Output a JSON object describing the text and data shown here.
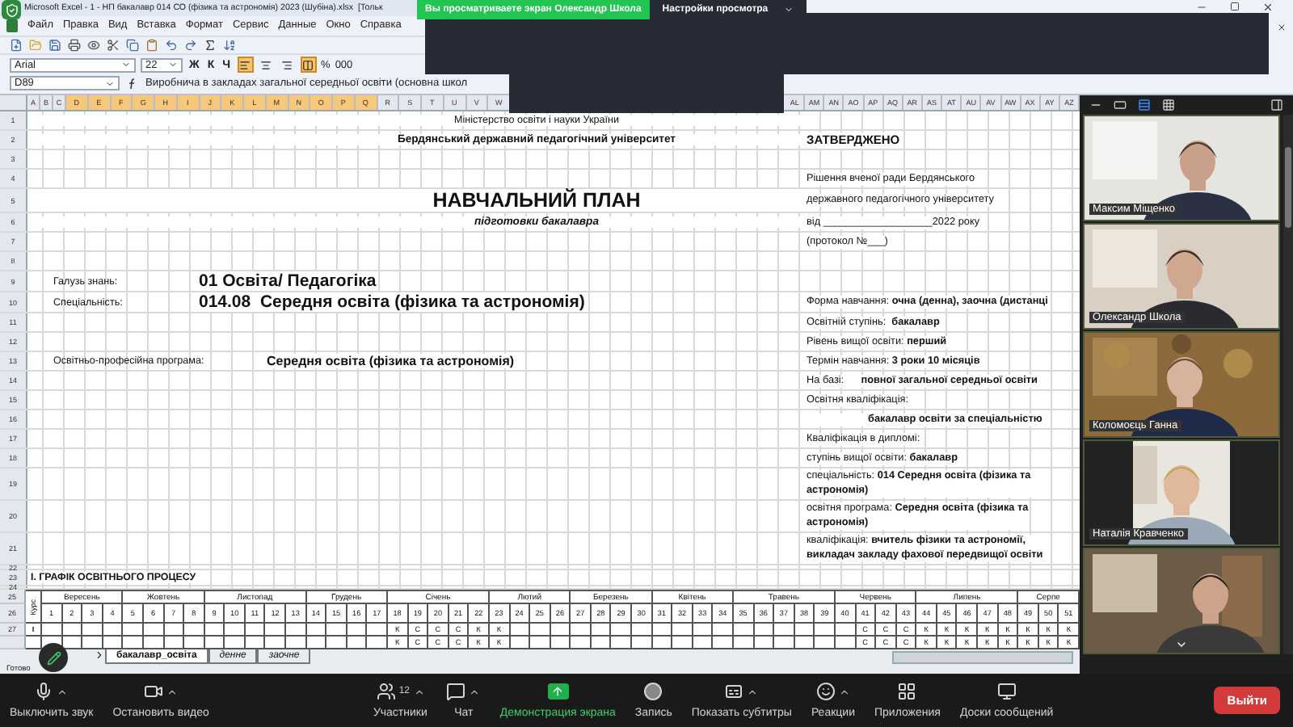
{
  "excel": {
    "title": "Microsoft Excel - 1 - НП бакалавр 014 СО (фізика та астрономія) 2023 (Шубіна).xlsx  [Тольк",
    "menu": [
      "Файл",
      "Правка",
      "Вид",
      "Вставка",
      "Формат",
      "Сервис",
      "Данные",
      "Окно",
      "Справка"
    ],
    "font": "Arial",
    "size": "22",
    "styles": [
      "Ж",
      "К",
      "Ч"
    ],
    "align": [
      {
        "kind": "left",
        "selected": true
      },
      {
        "kind": "center",
        "selected": false
      },
      {
        "kind": "right",
        "selected": false
      },
      {
        "kind": "merge",
        "selected": true
      }
    ],
    "number_formats": [
      "%",
      "000"
    ],
    "cell": "D89",
    "formula": "Виробнича в закладах загальної середньої освіти (основна школ"
  },
  "zoom_banner": {
    "text": "Вы просматриваете экран Олександр Школа",
    "settings": "Настройки просмотра"
  },
  "sheet": {
    "columns_left": [
      {
        "label": "A",
        "selected": false
      },
      {
        "label": "B",
        "selected": false
      },
      {
        "label": "C",
        "selected": false
      },
      {
        "label": "D",
        "selected": true
      },
      {
        "label": "E",
        "selected": true
      },
      {
        "label": "F",
        "selected": true
      },
      {
        "label": "G",
        "selected": true
      },
      {
        "label": "H",
        "selected": true
      },
      {
        "label": "I",
        "selected": true
      },
      {
        "label": "J",
        "selected": true
      },
      {
        "label": "K",
        "selected": true
      },
      {
        "label": "L",
        "selected": true
      },
      {
        "label": "M",
        "selected": true
      },
      {
        "label": "N",
        "selected": true
      },
      {
        "label": "O",
        "selected": true
      },
      {
        "label": "P",
        "selected": true
      },
      {
        "label": "Q",
        "selected": true
      },
      {
        "label": "R",
        "selected": false
      },
      {
        "label": "S",
        "selected": false
      },
      {
        "label": "T",
        "selected": false
      },
      {
        "label": "U",
        "selected": false
      },
      {
        "label": "V",
        "selected": false
      },
      {
        "label": "W",
        "selected": false
      }
    ],
    "columns_right": [
      {
        "label": "AL",
        "selected": false
      },
      {
        "label": "AM",
        "selected": false
      },
      {
        "label": "AN",
        "selected": false
      },
      {
        "label": "AO",
        "selected": false
      },
      {
        "label": "AP",
        "selected": false
      },
      {
        "label": "AQ",
        "selected": false
      },
      {
        "label": "AR",
        "selected": false
      },
      {
        "label": "AS",
        "selected": false
      },
      {
        "label": "AT",
        "selected": false
      },
      {
        "label": "AU",
        "selected": false
      },
      {
        "label": "AV",
        "selected": false
      },
      {
        "label": "AW",
        "selected": false
      },
      {
        "label": "AX",
        "selected": false
      },
      {
        "label": "AY",
        "selected": false
      },
      {
        "label": "AZ",
        "selected": false
      }
    ],
    "rows": [
      {
        "number": "1",
        "left": {
          "kind": "note",
          "text": "Міністерство освіти і науки України"
        }
      },
      {
        "number": "2",
        "left": {
          "kind": "institution",
          "text": "Бердянський державний педагогічний університет"
        },
        "right": {
          "kind": "heading",
          "lines": [
            "ЗАТВЕРДЖЕНО"
          ]
        }
      },
      {
        "number": "3"
      },
      {
        "number": "4",
        "right": {
          "kind": "text",
          "lines": [
            "Рішення вченої ради Бердянського"
          ]
        }
      },
      {
        "number": "5",
        "left": {
          "kind": "title",
          "text": "НАВЧАЛЬНИЙ ПЛАН"
        },
        "right": {
          "kind": "text",
          "lines": [
            "державного педагогічного університету"
          ]
        }
      },
      {
        "number": "6",
        "left": {
          "kind": "subtitle",
          "text": "підготовки бакалавра"
        },
        "right": {
          "kind": "text",
          "lines": [
            "від ___________________2022 року"
          ]
        }
      },
      {
        "number": "7",
        "right": {
          "kind": "text",
          "lines": [
            "(протокол №___)"
          ]
        }
      },
      {
        "number": "8"
      },
      {
        "number": "9",
        "left": {
          "kind": "field",
          "label": "Галузь знань:",
          "value": "01 Освіта/ Педагогіка"
        }
      },
      {
        "number": "10",
        "left": {
          "kind": "field",
          "label": "Спеціальність:",
          "value": "014.08  Середня освіта (фізика та астрономія)"
        },
        "right": {
          "kind": "text",
          "lines": [
            "Форма навчання: **очна (денна), заочна (дистанці**"
          ]
        }
      },
      {
        "number": "11",
        "right": {
          "kind": "text",
          "lines": [
            "Освітній ступінь:  **бакалавр**"
          ]
        }
      },
      {
        "number": "12",
        "right": {
          "kind": "text",
          "lines": [
            "Рівень вищої освіти: **перший**"
          ]
        }
      },
      {
        "number": "13",
        "left": {
          "kind": "program",
          "label": "Освітньо-професійна програма:",
          "value": "Середня освіта (фізика та астрономія)"
        },
        "right": {
          "kind": "text",
          "lines": [
            "Термін навчання: **3 роки 10 місяців**"
          ]
        }
      },
      {
        "number": "14",
        "right": {
          "kind": "text",
          "lines": [
            "На базі:      **повної загальної середньої освіти**"
          ]
        }
      },
      {
        "number": "15",
        "right": {
          "kind": "text",
          "lines": [
            "Освітня кваліфікація:"
          ]
        }
      },
      {
        "number": "16",
        "right": {
          "kind": "indent",
          "lines": [
            "бакалавр освіти за спеціальністю"
          ]
        }
      },
      {
        "number": "17",
        "right": {
          "kind": "text",
          "lines": [
            "Кваліфікація в дипломі:"
          ]
        }
      },
      {
        "number": "18",
        "right": {
          "kind": "text",
          "lines": [
            "ступінь вищої освіти: **бакалавр**"
          ]
        }
      },
      {
        "number": "19",
        "right": {
          "kind": "text",
          "lines": [
            "спеціальність: **014 Середня освіта (фізика та**",
            "**астрономія)**"
          ]
        }
      },
      {
        "number": "20",
        "right": {
          "kind": "text",
          "lines": [
            "освітня програма: **Середня освіта (фізика та**",
            "**астрономія)**"
          ]
        }
      },
      {
        "number": "21",
        "right": {
          "kind": "text",
          "lines": [
            "кваліфікація: **вчитель фізики та астрономії,**",
            "**викладач закладу фахової передвищої освіти**"
          ]
        }
      },
      {
        "number": "22"
      },
      {
        "number": "23",
        "left": {
          "kind": "section",
          "text": "І. ГРАФІК ОСВІТНЬОГО ПРОЦЕСУ"
        }
      },
      {
        "number": "24"
      }
    ],
    "schedule": {
      "course_header": "Курс",
      "numbers": [
        "25",
        "26"
      ],
      "months": [
        {
          "name": "Вересень",
          "weeks": [
            "1",
            "2",
            "3",
            "4"
          ]
        },
        {
          "name": "Жовтень",
          "weeks": [
            "5",
            "6",
            "7",
            "8"
          ]
        },
        {
          "name": "Листопад",
          "weeks": [
            "9",
            "10",
            "11",
            "12",
            "13"
          ]
        },
        {
          "name": "Грудень",
          "weeks": [
            "14",
            "15",
            "16",
            "17"
          ]
        },
        {
          "name": "Січень",
          "weeks": [
            "18",
            "19",
            "20",
            "21",
            "22"
          ]
        },
        {
          "name": "Лютий",
          "weeks": [
            "23",
            "24",
            "25",
            "26"
          ]
        },
        {
          "name": "Березень",
          "weeks": [
            "27",
            "28",
            "29",
            "30"
          ]
        },
        {
          "name": "Квітень",
          "weeks": [
            "31",
            "32",
            "33",
            "34"
          ]
        },
        {
          "name": "Травень",
          "weeks": [
            "35",
            "36",
            "37",
            "38",
            "39"
          ]
        },
        {
          "name": "Червень",
          "weeks": [
            "40",
            "41",
            "42",
            "43"
          ]
        },
        {
          "name": "Липень",
          "weeks": [
            "44",
            "45",
            "46",
            "47",
            "48"
          ]
        },
        {
          "name": "Серпе",
          "weeks": [
            "49",
            "50",
            "51"
          ]
        }
      ],
      "rows": [
        {
          "number": "27",
          "course": "I",
          "cells": [
            null,
            null,
            null,
            null,
            null,
            null,
            null,
            null,
            null,
            null,
            null,
            null,
            null,
            null,
            null,
            null,
            null,
            "К",
            "С",
            "С",
            "С",
            "К",
            "К",
            null,
            null,
            null,
            null,
            null,
            null,
            null,
            null,
            null,
            null,
            null,
            null,
            null,
            null,
            null,
            null,
            null,
            "С",
            "С",
            "С",
            "К",
            "К",
            "К",
            "К",
            "К",
            "К",
            "К",
            "К"
          ]
        },
        {
          "cells": [
            null,
            null,
            null,
            null,
            null,
            null,
            null,
            null,
            null,
            null,
            null,
            null,
            null,
            null,
            null,
            null,
            null,
            "К",
            "С",
            "С",
            "С",
            "К",
            "К",
            null,
            null,
            null,
            null,
            null,
            null,
            null,
            null,
            null,
            null,
            null,
            null,
            null,
            null,
            null,
            null,
            null,
            "С",
            "С",
            "С",
            "К",
            "К",
            "К",
            "К",
            "К",
            "К",
            "К",
            "К"
          ]
        }
      ]
    },
    "tabs": [
      {
        "label": "бакалавр_освіта",
        "selected": true
      },
      {
        "label": "денне",
        "selected": false
      },
      {
        "label": "заочне",
        "selected": false
      }
    ]
  },
  "status": "Готово",
  "participants": [
    {
      "kind": "video",
      "name": "Максим Міщенко"
    },
    {
      "kind": "video",
      "name": "Олександр Школа"
    },
    {
      "kind": "video",
      "name": "Коломоєць Ганна"
    },
    {
      "kind": "video",
      "name": "Наталія Кравченко"
    },
    {
      "kind": "video"
    }
  ],
  "toolbar": [
    {
      "kind": "mic",
      "label": "Выключить звук",
      "menu": true
    },
    {
      "kind": "camera",
      "label": "Остановить видео",
      "menu": true
    },
    {
      "kind": "participants",
      "label": "Участники",
      "count": "12",
      "menu": true
    },
    {
      "kind": "chat",
      "label": "Чат",
      "menu": true
    },
    {
      "kind": "share",
      "label": "Демонстрация экрана",
      "menu": false
    },
    {
      "kind": "record",
      "label": "Запись",
      "menu": false
    },
    {
      "kind": "captions",
      "label": "Показать субтитры",
      "menu": true
    },
    {
      "kind": "reactions",
      "label": "Реакции",
      "menu": true
    },
    {
      "kind": "apps",
      "label": "Приложения",
      "menu": false
    },
    {
      "kind": "whiteboard",
      "label": "Доски сообщений",
      "menu": false
    }
  ],
  "leave": "Выйти"
}
